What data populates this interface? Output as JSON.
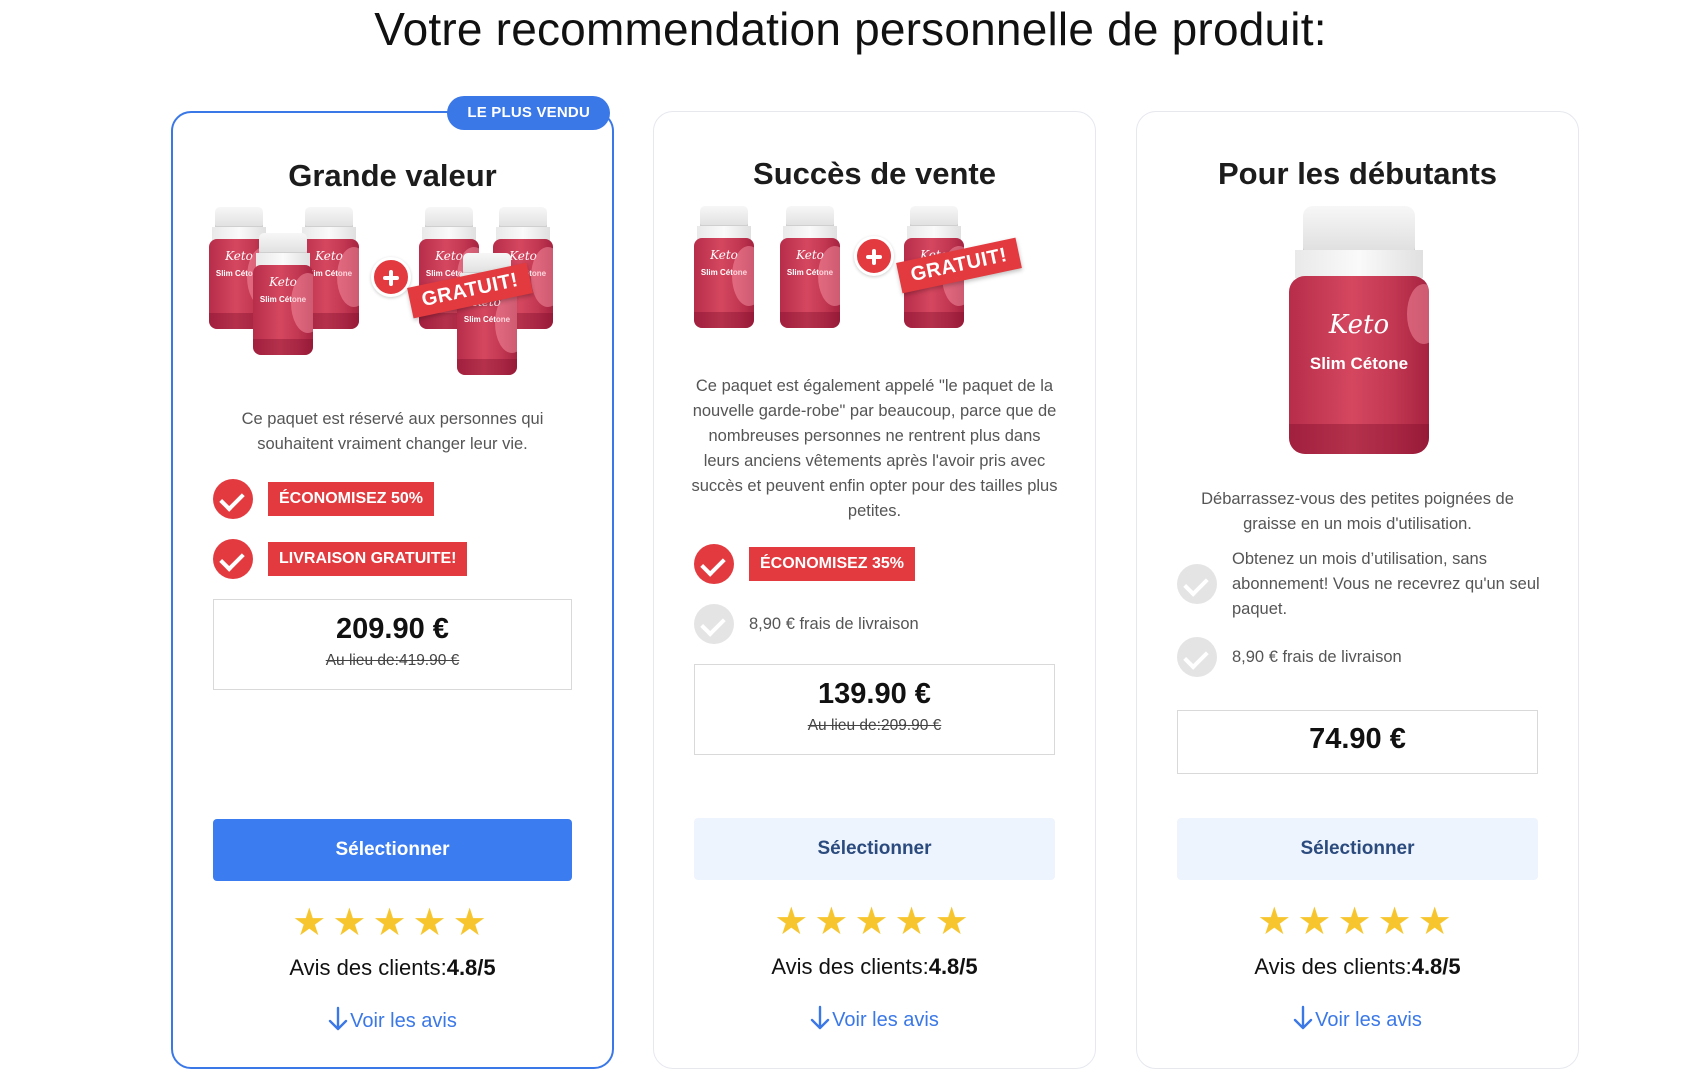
{
  "page_title": "Votre recommendation personnelle de produit:",
  "colors": {
    "accent": "#3b78e7",
    "badge_red": "#e23a3f",
    "star": "#f7c62f",
    "button_secondary_bg": "#eef4fd"
  },
  "icons": {
    "check": "check-circle-icon",
    "plus": "plus-circle-icon",
    "star": "star-icon",
    "arrow": "arrow-down-icon"
  },
  "cards": [
    {
      "ribbon": "LE PLUS VENDU",
      "title": "Grande valeur",
      "product_brand": "Keto",
      "product_name": "Slim Cétone",
      "free_tag": "GRATUIT!",
      "description": "Ce paquet est réservé aux personnes qui souhaitent vraiment changer leur vie.",
      "features": [
        {
          "text": "ÉCONOMISEZ 50%",
          "style": "badge"
        },
        {
          "text": "LIVRAISON GRATUITE!",
          "style": "badge"
        }
      ],
      "price": "209.90 €",
      "old_price": "Au lieu de:419.90 €",
      "button": "Sélectionner",
      "rating_label": "Avis des clients:",
      "rating_value": "4.8/5",
      "stars": 5,
      "reviews_link": "Voir les avis"
    },
    {
      "title": "Succès de vente",
      "product_brand": "Keto",
      "product_name": "Slim Cétone",
      "free_tag": "GRATUIT!",
      "description": "Ce paquet est également appelé \"le paquet de la nouvelle garde-robe\" par beaucoup, parce que de nombreuses personnes ne rentrent plus dans leurs anciens vêtements après l'avoir pris avec succès et peuvent enfin opter pour des tailles plus petites.",
      "features": [
        {
          "text": "ÉCONOMISEZ 35%",
          "style": "badge"
        },
        {
          "text": "8,90 € frais de livraison",
          "style": "plain"
        }
      ],
      "price": "139.90 €",
      "old_price": "Au lieu de:209.90 €",
      "button": "Sélectionner",
      "rating_label": "Avis des clients:",
      "rating_value": "4.8/5",
      "stars": 5,
      "reviews_link": "Voir les avis"
    },
    {
      "title": "Pour les débutants",
      "product_brand": "Keto",
      "product_name": "Slim Cétone",
      "description": "Débarrassez-vous des petites poignées de graisse en un mois d'utilisation.",
      "features": [
        {
          "text": "Obtenez un mois d’utilisation, sans abonnement! Vous ne recevrez qu'un seul paquet.",
          "style": "plain"
        },
        {
          "text": "8,90 € frais de livraison",
          "style": "plain"
        }
      ],
      "price": "74.90 €",
      "button": "Sélectionner",
      "rating_label": "Avis des clients:",
      "rating_value": "4.8/5",
      "stars": 5,
      "reviews_link": "Voir les avis"
    }
  ]
}
